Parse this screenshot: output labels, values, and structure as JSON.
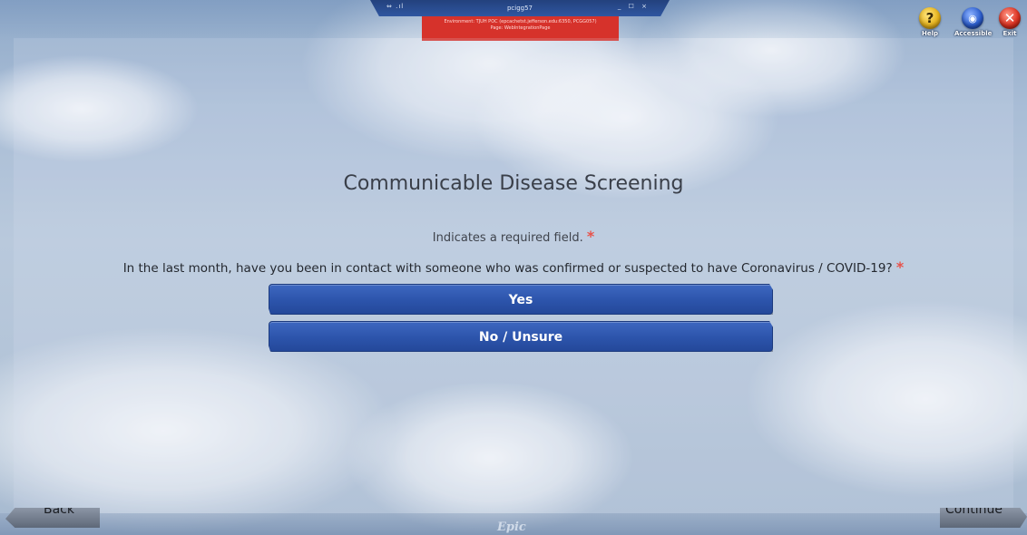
{
  "window": {
    "title": "pcigg57",
    "signal_icon": "signal-icon",
    "controls": "_ ☐ ×",
    "environment_line1": "Environment: TJUH POC (epcachetst.jefferson.edu:6350, PCGG057)",
    "environment_line2": "Page: WebIntegrationPage"
  },
  "toolbar": {
    "help_label": "Help",
    "help_glyph": "?",
    "accessible_label": "Accessible",
    "accessible_glyph": "◉",
    "exit_label": "Exit",
    "exit_glyph": "✕"
  },
  "form": {
    "title": "Communicable Disease Screening",
    "required_note": "Indicates a required field.",
    "required_marker": "*",
    "question": "In the last month, have you been in contact with someone who was confirmed or suspected to have Coronavirus / COVID-19?",
    "options": [
      "Yes",
      "No / Unsure"
    ]
  },
  "navigation": {
    "back_label": "Back",
    "continue_label": "Continue",
    "logo_text": "Epic"
  },
  "colors": {
    "accent": "#2c54ab",
    "required": "#e8524a",
    "banner": "#d6322b"
  }
}
